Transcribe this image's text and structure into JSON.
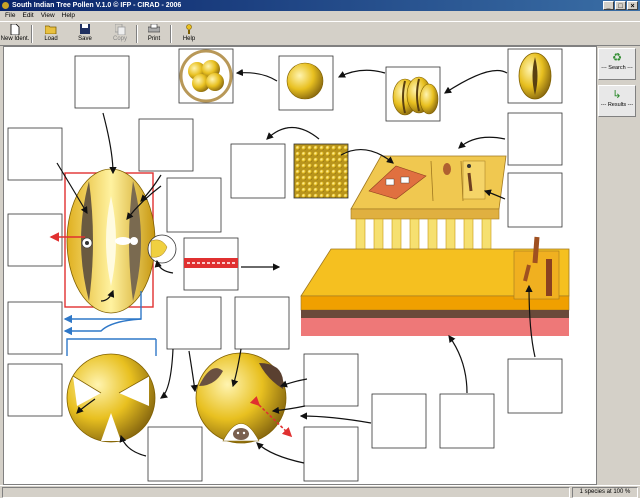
{
  "window": {
    "title": "South Indian Tree Pollen V.1.0 © IFP - CIRAD - 2006"
  },
  "menu": [
    "File",
    "Edit",
    "View",
    "Help"
  ],
  "toolbar": {
    "new": "New Ident.",
    "load": "Load",
    "save": "Save",
    "copy": "Copy",
    "print": "Print",
    "help": "Help"
  },
  "side": {
    "search": "--- Search ---",
    "results": "--- Results ---"
  },
  "status": {
    "species": "1 species at 100 %"
  },
  "icons": {
    "new": "new-document-icon",
    "load": "open-folder-icon",
    "save": "floppy-disk-icon",
    "copy": "copy-icon",
    "print": "printer-icon",
    "help": "help-icon",
    "search": "recycle-search-icon",
    "results": "results-arrow-icon"
  },
  "colors": {
    "pollen": "#e8c020",
    "pollen_dark": "#8a6a10",
    "arrow_red": "#e03030",
    "arrow_blue": "#3070c0"
  }
}
